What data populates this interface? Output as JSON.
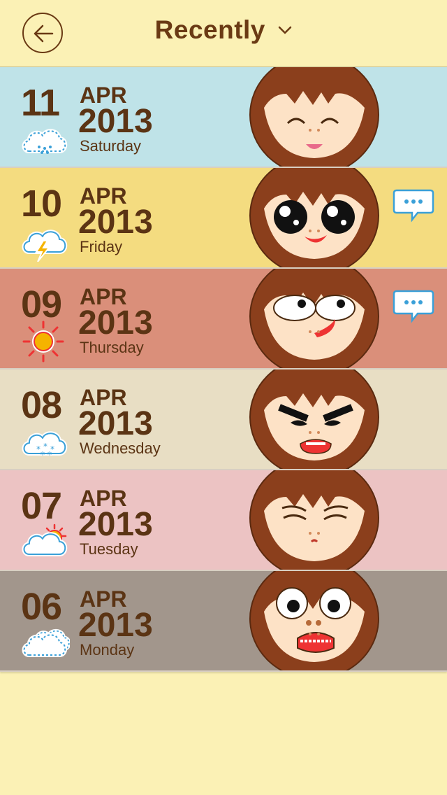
{
  "header": {
    "title": "Recently"
  },
  "colors": {
    "background": "#fbf1b5",
    "brown": "#5b3414"
  },
  "entries": [
    {
      "day": "11",
      "month": "APR",
      "year": "2013",
      "weekday": "Saturday",
      "weather": "rain-cloud-icon",
      "color": "#bfe3e8",
      "mood": "happy",
      "has_comment": false
    },
    {
      "day": "10",
      "month": "APR",
      "year": "2013",
      "weekday": "Friday",
      "weather": "thunderstorm-icon",
      "color": "#f4dc80",
      "mood": "excited",
      "has_comment": true
    },
    {
      "day": "09",
      "month": "APR",
      "year": "2013",
      "weekday": "Thursday",
      "weather": "sun-icon",
      "color": "#da8f7a",
      "mood": "silly",
      "has_comment": true
    },
    {
      "day": "08",
      "month": "APR",
      "year": "2013",
      "weekday": "Wednesday",
      "weather": "snow-cloud-icon",
      "color": "#e8dec4",
      "mood": "angry",
      "has_comment": false
    },
    {
      "day": "07",
      "month": "APR",
      "year": "2013",
      "weekday": "Tuesday",
      "weather": "partly-cloudy-icon",
      "color": "#ecc3c3",
      "mood": "sad",
      "has_comment": false
    },
    {
      "day": "06",
      "month": "APR",
      "year": "2013",
      "weekday": "Monday",
      "weather": "cloudy-icon",
      "color": "#a2968c",
      "mood": "scared",
      "has_comment": false
    }
  ]
}
